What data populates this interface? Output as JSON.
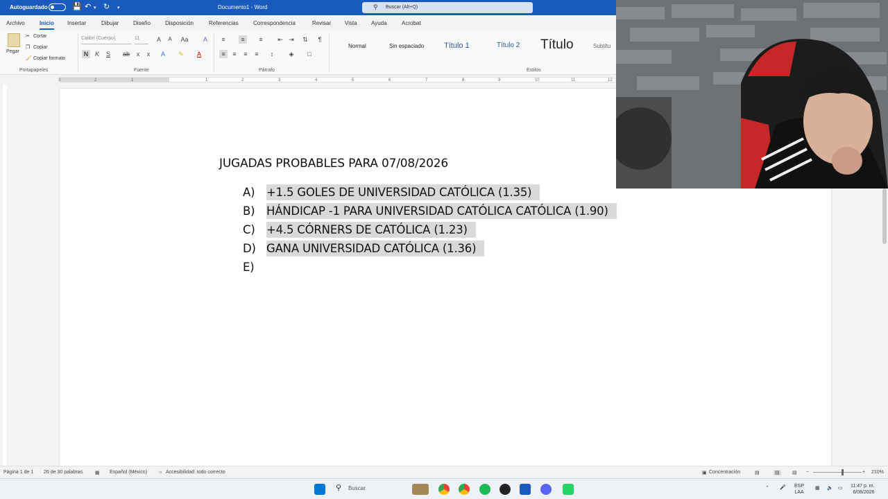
{
  "titlebar": {
    "autosave": "Autoguardado",
    "doc_title": "Documento1 - Word",
    "search_placeholder": "Buscar (Alt+Q)"
  },
  "tabs": [
    "Archivo",
    "Inicio",
    "Insertar",
    "Dibujar",
    "Diseño",
    "Disposición",
    "Referencias",
    "Correspondencia",
    "Revisar",
    "Vista",
    "Ayuda",
    "Acrobat"
  ],
  "ribbon": {
    "clipboard": {
      "paste": "Pegar",
      "cut": "Cortar",
      "copy": "Copiar",
      "format_painter": "Copiar formato",
      "label": "Portapapeles"
    },
    "font": {
      "name": "Calibri (Cuerpo)",
      "size": "11",
      "label": "Fuente"
    },
    "paragraph": {
      "label": "Párrafo"
    },
    "styles": {
      "items": [
        "Normal",
        "Sin espaciado",
        "Título 1",
        "Título 2",
        "Título",
        "Subtítu"
      ],
      "label": "Estilos"
    }
  },
  "ruler": {
    "numbers": [
      "3",
      "2",
      "1",
      "1",
      "2",
      "3",
      "4",
      "5",
      "6",
      "7",
      "8",
      "9",
      "10",
      "11",
      "12"
    ]
  },
  "document": {
    "heading": "JUGADAS PROBABLES PARA 07/08/2026",
    "items": [
      {
        "letter": "A)",
        "text": "+1.5 GOLES DE UNIVERSIDAD CATÓLICA (1.35)"
      },
      {
        "letter": "B)",
        "text": "HÁNDICAP -1 PARA UNIVERSIDAD CATÓLICA CATÓLICA (1.90)"
      },
      {
        "letter": "C)",
        "text": "+4.5 CÓRNERS DE CATÓLICA (1.23)"
      },
      {
        "letter": "D)",
        "text": "GANA UNIVERSIDAD CATÓLICA (1.36)"
      },
      {
        "letter": "E)",
        "text": ""
      }
    ]
  },
  "statusbar": {
    "page": "Página 1 de 1",
    "words": "26 de 30 palabras",
    "language": "Español (México)",
    "accessibility": "Accesibilidad: todo correcto",
    "focus": "Concentración",
    "zoom": "210%"
  },
  "taskbar": {
    "search": "Buscar",
    "lang_top": "ESP",
    "lang_bottom": "LAA",
    "time": "11:47 p. m.",
    "date": "6/08/2026"
  },
  "colors": {
    "word_blue": "#185abd",
    "highlight": "#d9d9d9"
  }
}
